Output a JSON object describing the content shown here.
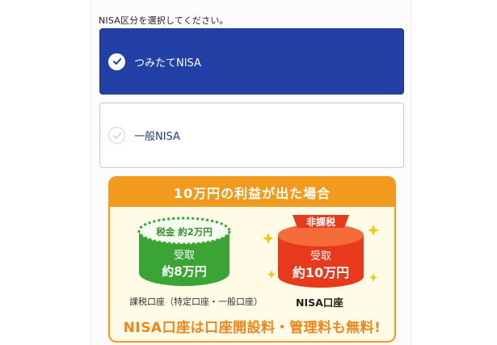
{
  "form": {
    "instruction": "NISA区分を選択してください。",
    "options": [
      {
        "label": "つみたてNISA",
        "selected": true
      },
      {
        "label": "一般NISA",
        "selected": false
      }
    ]
  },
  "banner": {
    "title": "10万円の利益が出た場合",
    "taxable": {
      "tax_tag": "税金 約2万円",
      "receive_line1": "受取",
      "receive_line2": "約8万円",
      "caption": "課税口座（特定口座・一般口座）"
    },
    "nisa": {
      "badge": "非課税",
      "receive_line1": "受取",
      "receive_line2": "約10万円",
      "caption": "NISA口座"
    },
    "footer": "NISA口座は口座開設料・管理料も無料!"
  },
  "colors": {
    "selected_bg": "#2240a5",
    "accent_orange": "#f29a1e",
    "green": "#3aa534",
    "red": "#e8391d"
  }
}
